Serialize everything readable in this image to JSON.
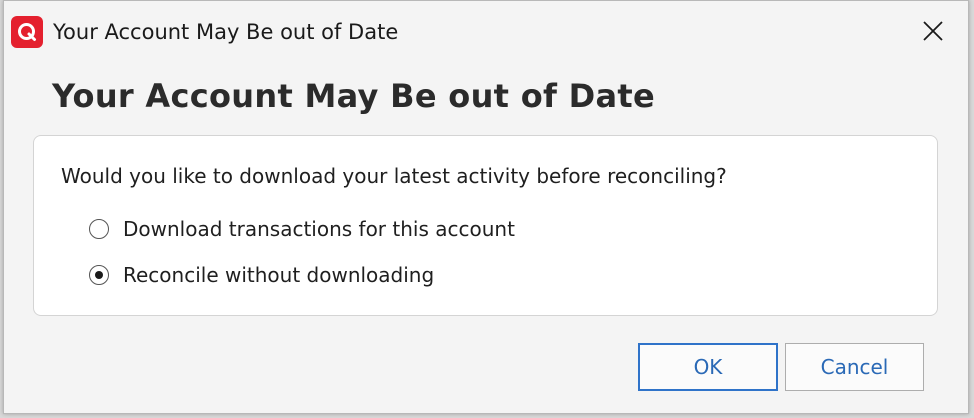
{
  "window": {
    "title": "Your Account May Be out of Date",
    "close_glyph": "✕"
  },
  "dialog": {
    "heading": "Your Account May Be out of Date",
    "question": "Would you like to download your latest activity before reconciling?",
    "options": [
      {
        "label": "Download transactions for this account",
        "selected": false
      },
      {
        "label": "Reconcile without downloading",
        "selected": true
      }
    ]
  },
  "buttons": {
    "ok": "OK",
    "cancel": "Cancel"
  },
  "colors": {
    "brand": "#e4202e",
    "accent": "#2f73c9",
    "button_text": "#2a69b6"
  },
  "icons": {
    "app": "quicken-logo-icon",
    "close": "close-icon"
  }
}
